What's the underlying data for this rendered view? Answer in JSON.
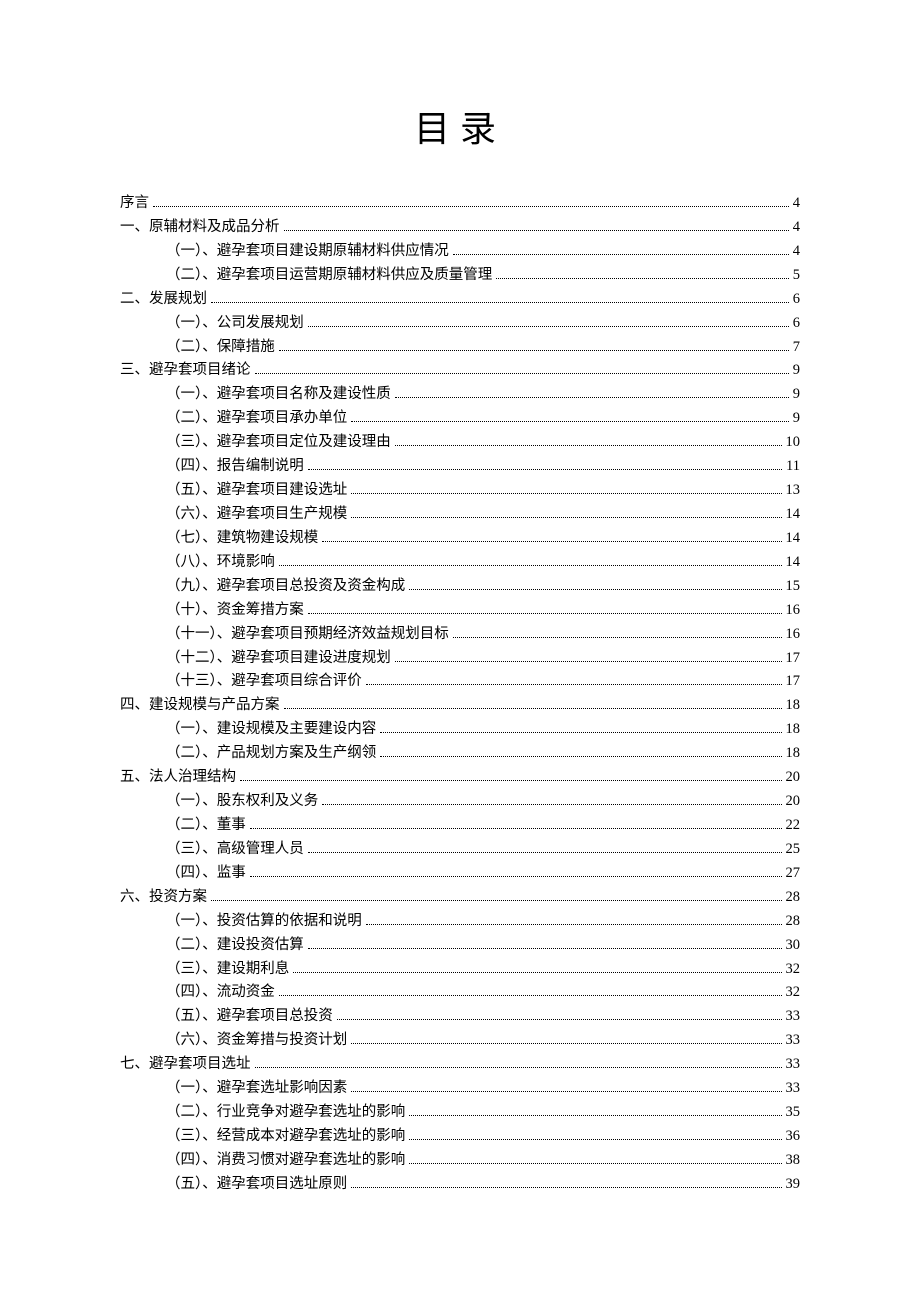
{
  "title": "目录",
  "toc": [
    {
      "level": 0,
      "label": "序言",
      "page": "4"
    },
    {
      "level": 0,
      "label": "一、原辅材料及成品分析",
      "page": "4"
    },
    {
      "level": 1,
      "label": "（一）、避孕套项目建设期原辅材料供应情况",
      "page": "4"
    },
    {
      "level": 1,
      "label": "（二）、避孕套项目运营期原辅材料供应及质量管理",
      "page": "5"
    },
    {
      "level": 0,
      "label": "二、发展规划",
      "page": "6"
    },
    {
      "level": 1,
      "label": "（一）、公司发展规划",
      "page": "6"
    },
    {
      "level": 1,
      "label": "（二）、保障措施",
      "page": "7"
    },
    {
      "level": 0,
      "label": "三、避孕套项目绪论",
      "page": "9"
    },
    {
      "level": 1,
      "label": "（一）、避孕套项目名称及建设性质",
      "page": "9"
    },
    {
      "level": 1,
      "label": "（二）、避孕套项目承办单位",
      "page": "9"
    },
    {
      "level": 1,
      "label": "（三）、避孕套项目定位及建设理由",
      "page": "10"
    },
    {
      "level": 1,
      "label": "（四）、报告编制说明",
      "page": "11"
    },
    {
      "level": 1,
      "label": "（五）、避孕套项目建设选址",
      "page": "13"
    },
    {
      "level": 1,
      "label": "（六）、避孕套项目生产规模",
      "page": "14"
    },
    {
      "level": 1,
      "label": "（七）、建筑物建设规模",
      "page": "14"
    },
    {
      "level": 1,
      "label": "（八）、环境影响",
      "page": "14"
    },
    {
      "level": 1,
      "label": "（九）、避孕套项目总投资及资金构成",
      "page": "15"
    },
    {
      "level": 1,
      "label": "（十）、资金筹措方案",
      "page": "16"
    },
    {
      "level": 1,
      "label": "（十一）、避孕套项目预期经济效益规划目标",
      "page": "16"
    },
    {
      "level": 1,
      "label": "（十二）、避孕套项目建设进度规划",
      "page": "17"
    },
    {
      "level": 1,
      "label": "（十三）、避孕套项目综合评价",
      "page": "17"
    },
    {
      "level": 0,
      "label": "四、建设规模与产品方案",
      "page": "18"
    },
    {
      "level": 1,
      "label": "（一）、建设规模及主要建设内容",
      "page": "18"
    },
    {
      "level": 1,
      "label": "（二）、产品规划方案及生产纲领",
      "page": "18"
    },
    {
      "level": 0,
      "label": "五、法人治理结构",
      "page": "20"
    },
    {
      "level": 1,
      "label": "（一）、股东权利及义务",
      "page": "20"
    },
    {
      "level": 1,
      "label": "（二）、董事",
      "page": "22"
    },
    {
      "level": 1,
      "label": "（三）、高级管理人员",
      "page": "25"
    },
    {
      "level": 1,
      "label": "（四）、监事",
      "page": "27"
    },
    {
      "level": 0,
      "label": "六、投资方案",
      "page": "28"
    },
    {
      "level": 1,
      "label": "（一）、投资估算的依据和说明",
      "page": "28"
    },
    {
      "level": 1,
      "label": "（二）、建设投资估算",
      "page": "30"
    },
    {
      "level": 1,
      "label": "（三）、建设期利息",
      "page": "32"
    },
    {
      "level": 1,
      "label": "（四）、流动资金",
      "page": "32"
    },
    {
      "level": 1,
      "label": "（五）、避孕套项目总投资",
      "page": "33"
    },
    {
      "level": 1,
      "label": "（六）、资金筹措与投资计划",
      "page": "33"
    },
    {
      "level": 0,
      "label": "七、避孕套项目选址",
      "page": "33"
    },
    {
      "level": 1,
      "label": "（一）、避孕套选址影响因素",
      "page": "33"
    },
    {
      "level": 1,
      "label": "（二）、行业竞争对避孕套选址的影响",
      "page": "35"
    },
    {
      "level": 1,
      "label": "（三）、经营成本对避孕套选址的影响",
      "page": "36"
    },
    {
      "level": 1,
      "label": "（四）、消费习惯对避孕套选址的影响",
      "page": "38"
    },
    {
      "level": 1,
      "label": "（五）、避孕套项目选址原则",
      "page": "39"
    }
  ]
}
